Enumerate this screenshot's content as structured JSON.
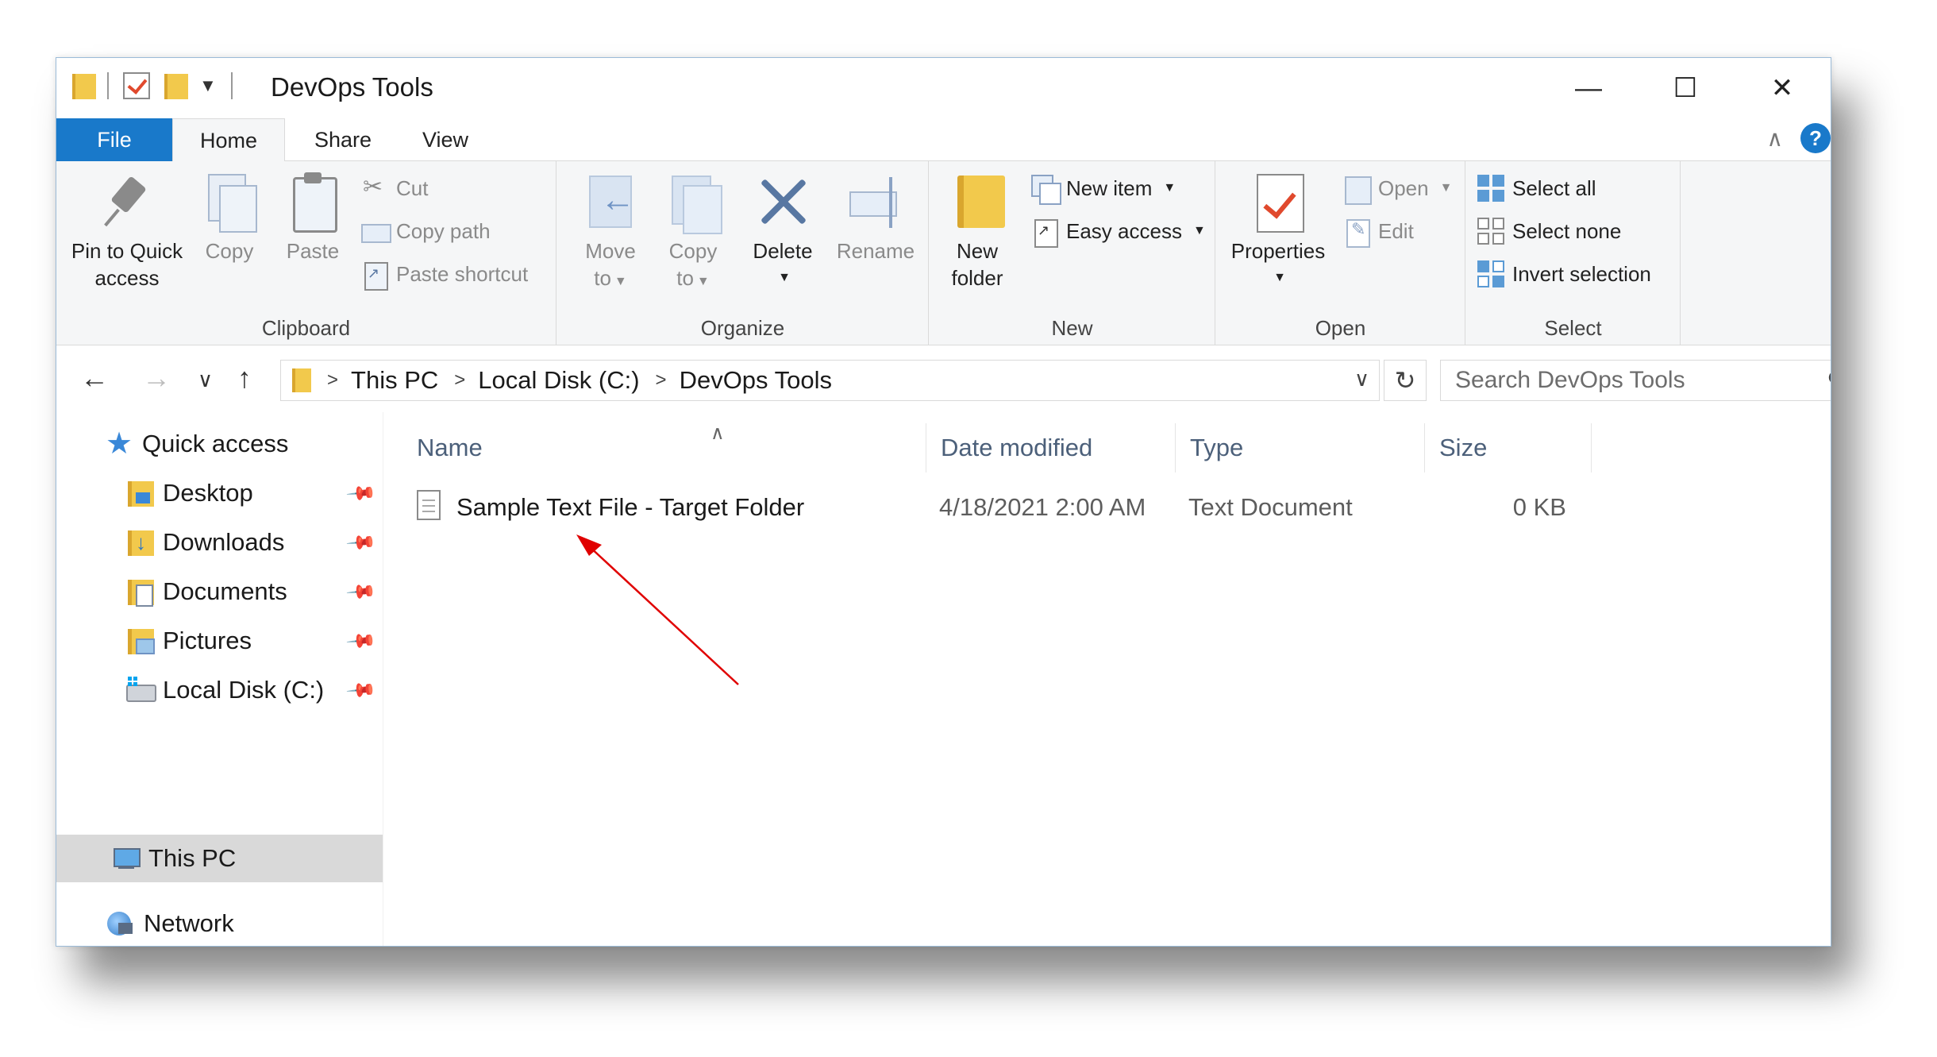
{
  "window": {
    "title": "DevOps Tools",
    "controls": {
      "minimize": "—",
      "maximize": "☐",
      "close": "✕"
    }
  },
  "ribbon_tabs": [
    {
      "label": "File"
    },
    {
      "label": "Home"
    },
    {
      "label": "Share"
    },
    {
      "label": "View"
    }
  ],
  "ribbon": {
    "clipboard": {
      "label": "Clipboard",
      "pin_line1": "Pin to Quick",
      "pin_line2": "access",
      "copy": "Copy",
      "paste": "Paste",
      "cut": "Cut",
      "copy_path": "Copy path",
      "paste_shortcut": "Paste shortcut"
    },
    "organize": {
      "label": "Organize",
      "move_line1": "Move",
      "move_line2": "to",
      "copy_line1": "Copy",
      "copy_line2": "to",
      "delete": "Delete",
      "rename": "Rename"
    },
    "new": {
      "label": "New",
      "folder_line1": "New",
      "folder_line2": "folder",
      "new_item": "New item",
      "easy_access": "Easy access"
    },
    "open": {
      "label": "Open",
      "properties": "Properties",
      "open": "Open",
      "edit": "Edit"
    },
    "select": {
      "label": "Select",
      "select_all": "Select all",
      "select_none": "Select none",
      "invert_selection": "Invert selection"
    }
  },
  "address": {
    "crumbs": [
      "This PC",
      "Local Disk (C:)",
      "DevOps Tools"
    ],
    "separator": ">",
    "search_placeholder": "Search DevOps Tools"
  },
  "nav_pane": {
    "quick_access": "Quick access",
    "items": [
      {
        "label": "Desktop",
        "icon": "desktop-folder-icon"
      },
      {
        "label": "Downloads",
        "icon": "downloads-folder-icon"
      },
      {
        "label": "Documents",
        "icon": "documents-folder-icon"
      },
      {
        "label": "Pictures",
        "icon": "pictures-folder-icon"
      },
      {
        "label": "Local Disk (C:)",
        "icon": "local-disk-icon"
      }
    ],
    "this_pc": "This PC",
    "network": "Network"
  },
  "file_list": {
    "columns": [
      "Name",
      "Date modified",
      "Type",
      "Size"
    ],
    "rows": [
      {
        "name": "Sample Text File - Target Folder",
        "date_modified": "4/18/2021 2:00 AM",
        "type": "Text Document",
        "size": "0 KB"
      }
    ]
  },
  "colors": {
    "accent": "#1979ca",
    "annotation_arrow": "#e00000"
  }
}
